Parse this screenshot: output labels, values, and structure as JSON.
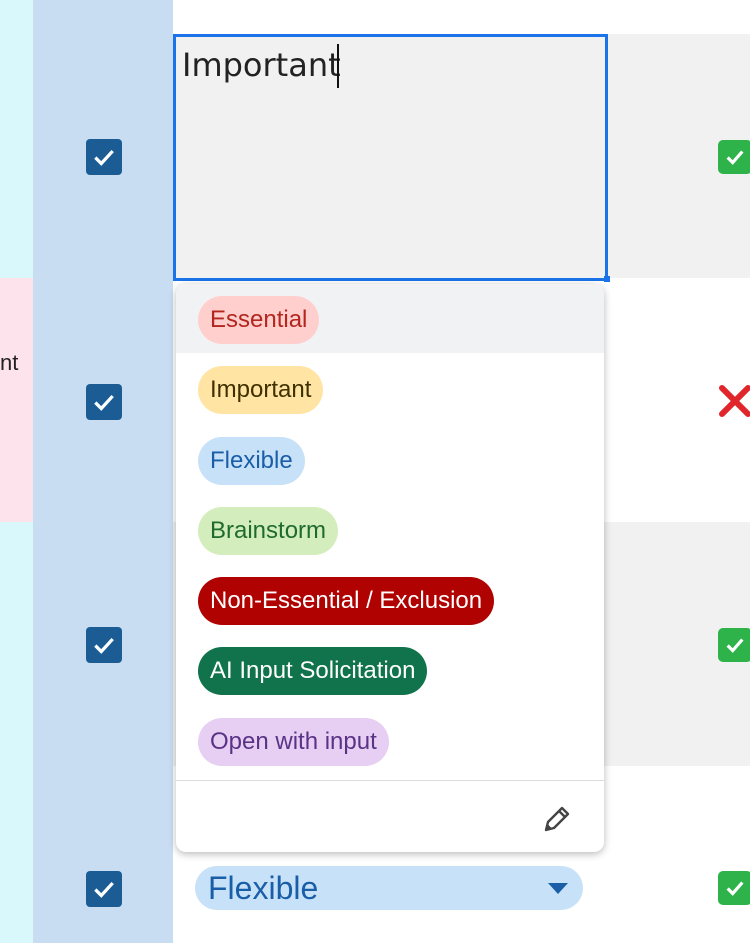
{
  "left_column": {
    "partial_text": "nt"
  },
  "editor": {
    "value": "Important"
  },
  "dropdown": {
    "options": [
      {
        "label": "Essential",
        "bg": "#fecfcd",
        "fg": "#b3261e"
      },
      {
        "label": "Important",
        "bg": "#ffe4a3",
        "fg": "#3f3000"
      },
      {
        "label": "Flexible",
        "bg": "#c7e2f8",
        "fg": "#1a5ea8"
      },
      {
        "label": "Brainstorm",
        "bg": "#d4edbc",
        "fg": "#1f6b2e"
      },
      {
        "label": "Non-Essential / Exclusion",
        "bg": "#b10202",
        "fg": "#ffffff"
      },
      {
        "label": "AI Input Solicitation",
        "bg": "#11734b",
        "fg": "#ffffff"
      },
      {
        "label": "Open with input",
        "bg": "#e6cff2",
        "fg": "#5a3286"
      }
    ],
    "edit_icon": "pencil-icon"
  },
  "rows": [
    {
      "checked": true,
      "status_icon": "check-mark-icon"
    },
    {
      "checked": true,
      "status_icon": "cross-mark-icon"
    },
    {
      "checked": true,
      "status_icon": "check-mark-icon"
    },
    {
      "checked": true,
      "status_icon": "check-mark-icon",
      "chip_value": "Flexible"
    }
  ],
  "colors": {
    "accent_blue": "#1a73e8",
    "checkbox_blue": "#1a5c93",
    "check_green": "#2db34a",
    "cross_red": "#e0262b"
  }
}
